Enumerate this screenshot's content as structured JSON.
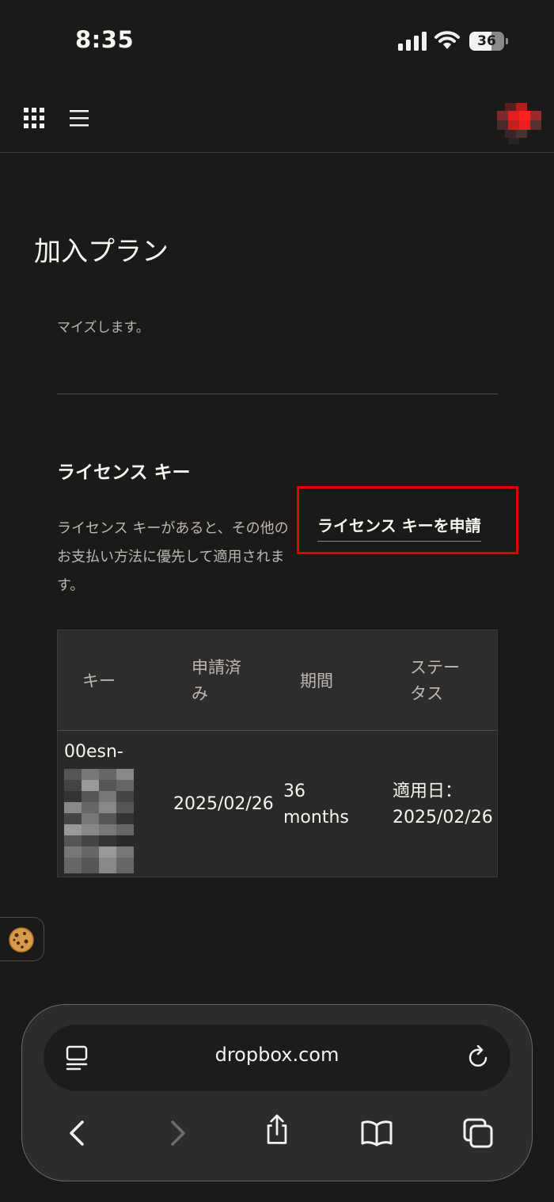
{
  "status_bar": {
    "time": "8:35",
    "battery": "36"
  },
  "page": {
    "title": "加入プラン",
    "intro_text": "マイズします。"
  },
  "license": {
    "title": "ライセンス キー",
    "description": "ライセンス キーがあると、その他のお支払い方法に優先して適用されます。",
    "request_link": "ライセンス キーを申請",
    "table": {
      "headers": {
        "key": "キー",
        "requested_line1": "申請済",
        "requested_line2": "み",
        "period": "期間",
        "status_line1": "ステー",
        "status_line2": "タス"
      },
      "rows": [
        {
          "key": "00esn-",
          "requested": "2025/02/26",
          "period_line1": "36",
          "period_line2": "months",
          "status_line1": "適用日：",
          "status_line2": "2025/02/26"
        }
      ]
    }
  },
  "browser": {
    "url": "dropbox.com"
  },
  "colors": {
    "background": "#1b1a19",
    "highlight": "#e00000",
    "text": "#f7f5f2",
    "muted": "#bbb8b3"
  }
}
